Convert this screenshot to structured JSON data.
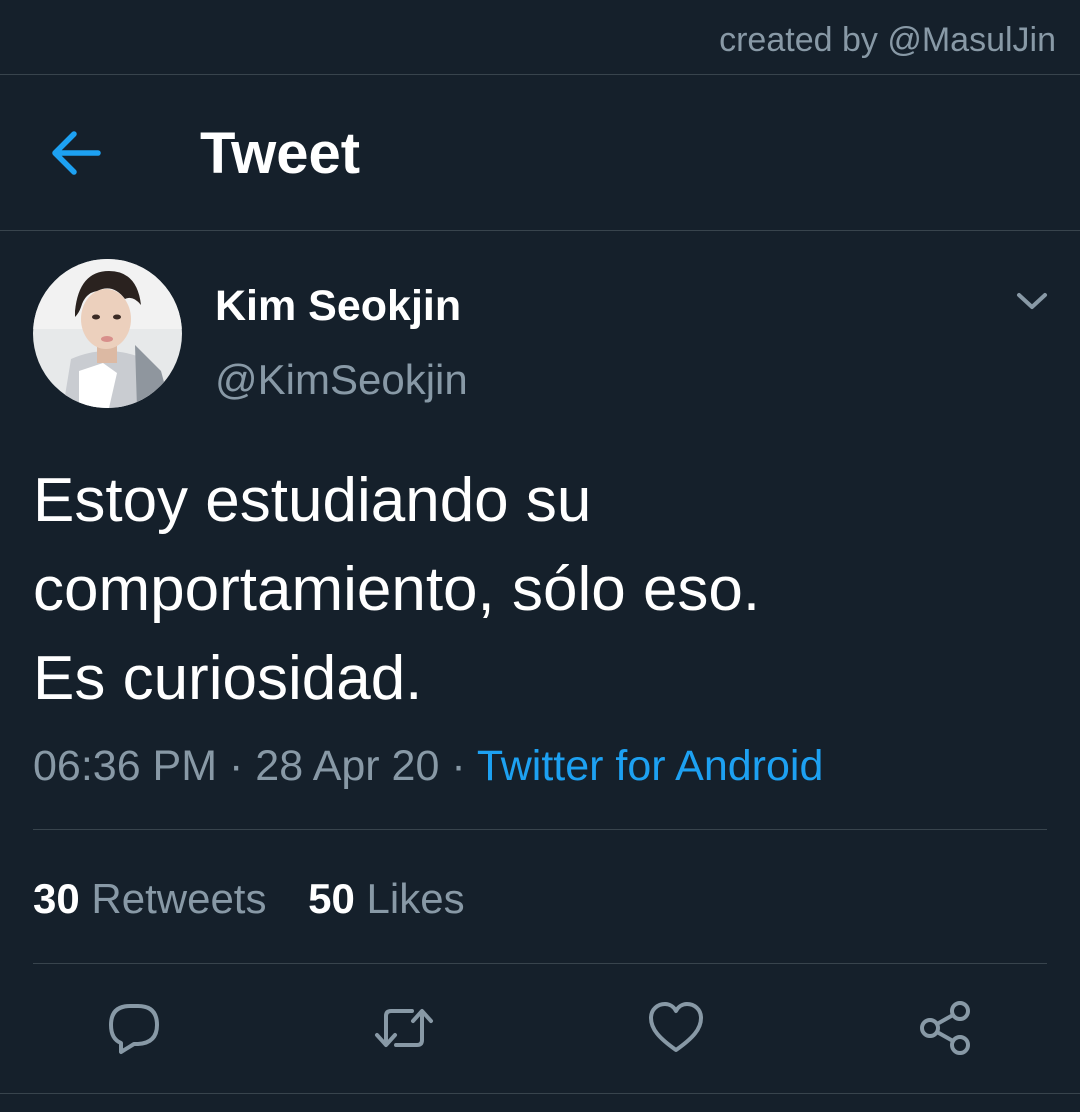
{
  "watermark": "created by @MasulJin",
  "header": {
    "back_icon": "arrow-left-icon",
    "title": "Tweet"
  },
  "tweet": {
    "author": {
      "display_name": "Kim Seokjin",
      "handle": "@KimSeokjin"
    },
    "text_lines": [
      "Estoy estudiando su",
      "comportamiento, sólo eso.",
      "Es curiosidad."
    ],
    "time": "06:36 PM",
    "date": "28 Apr 20",
    "separator": "·",
    "source": "Twitter for Android",
    "stats": {
      "retweets_count": "30",
      "retweets_label": "Retweets",
      "likes_count": "50",
      "likes_label": "Likes"
    }
  },
  "actions": [
    "reply-icon",
    "retweet-icon",
    "like-icon",
    "share-icon"
  ],
  "colors": {
    "background": "#15202b",
    "accent": "#1da1f2",
    "text_primary": "#ffffff",
    "text_secondary": "#8899a6",
    "divider": "#38444d"
  }
}
